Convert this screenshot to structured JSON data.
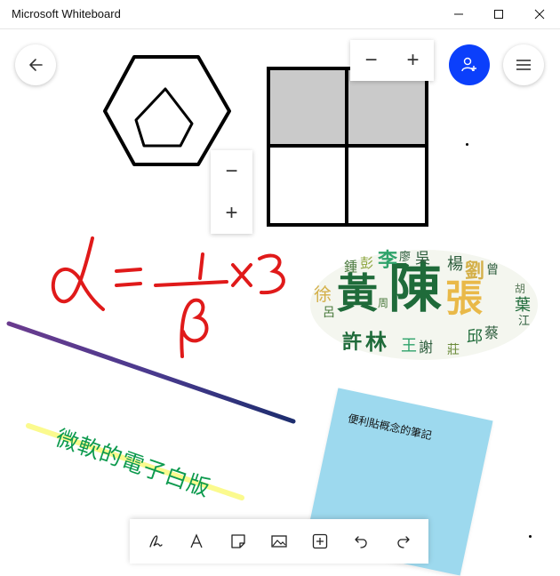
{
  "window": {
    "title": "Microsoft Whiteboard",
    "minimize_icon": "minimize-icon",
    "maximize_icon": "maximize-icon",
    "close_icon": "close-icon"
  },
  "controls": {
    "back_icon": "arrow-left-icon",
    "invite_icon": "add-person-icon",
    "menu_icon": "hamburger-menu-icon",
    "accent_color": "#0b3ffb"
  },
  "zoom": {
    "minus_label": "−",
    "plus_label": "+"
  },
  "canvas": {
    "formula_text": "α = 1/β × 3",
    "handwritten_text": "微軟的電子白版",
    "note_text": "便利貼概念的筆記",
    "word_cloud": {
      "words": [
        {
          "text": "陳",
          "color": "#1f6b3a"
        },
        {
          "text": "黃",
          "color": "#1f6b3a"
        },
        {
          "text": "張",
          "color": "#e9b949"
        },
        {
          "text": "李",
          "color": "#2fa36b"
        },
        {
          "text": "林",
          "color": "#1f6b3a"
        },
        {
          "text": "許",
          "color": "#1f6b3a"
        },
        {
          "text": "劉",
          "color": "#d4b04a"
        },
        {
          "text": "曾",
          "color": "#2e5e3e"
        },
        {
          "text": "彭",
          "color": "#8aa43a"
        },
        {
          "text": "鍾",
          "color": "#4a7a3e"
        },
        {
          "text": "吳",
          "color": "#2e5e3e"
        },
        {
          "text": "廖",
          "color": "#2e5e3e"
        },
        {
          "text": "楊",
          "color": "#2e5e3e"
        },
        {
          "text": "徐",
          "color": "#d4b04a"
        },
        {
          "text": "葉",
          "color": "#1f6b3a"
        },
        {
          "text": "王",
          "color": "#2fa36b"
        },
        {
          "text": "謝",
          "color": "#2e5e3e"
        },
        {
          "text": "莊",
          "color": "#6a8a3a"
        },
        {
          "text": "邱",
          "color": "#1f6b3a"
        },
        {
          "text": "蔡",
          "color": "#2e5e3e"
        },
        {
          "text": "江",
          "color": "#2e5e3e"
        },
        {
          "text": "呂",
          "color": "#4a7a3e"
        },
        {
          "text": "胡",
          "color": "#5a7a5a"
        },
        {
          "text": "周",
          "color": "#4a7a3e"
        }
      ]
    }
  },
  "toolbar": {
    "tools": [
      {
        "name": "pen-tool",
        "icon": "pen-icon"
      },
      {
        "name": "text-tool",
        "icon": "text-icon"
      },
      {
        "name": "note-tool",
        "icon": "sticky-note-icon"
      },
      {
        "name": "image-tool",
        "icon": "image-icon"
      },
      {
        "name": "insert-tool",
        "icon": "add-box-icon"
      },
      {
        "name": "undo-tool",
        "icon": "undo-icon"
      },
      {
        "name": "redo-tool",
        "icon": "redo-icon"
      }
    ]
  }
}
